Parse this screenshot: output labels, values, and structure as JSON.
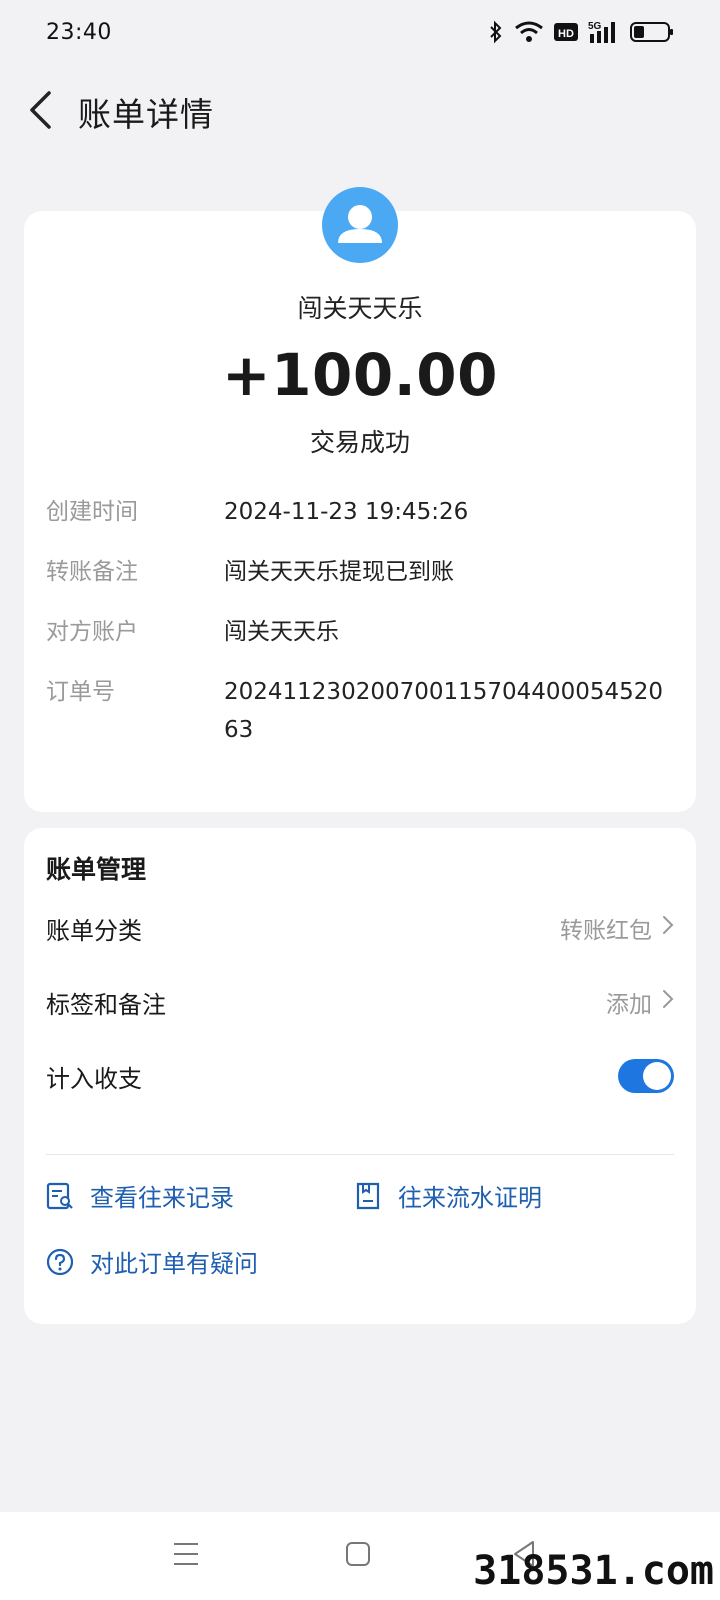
{
  "status_bar": {
    "time": "23:40",
    "icons": [
      "bluetooth-icon",
      "wifi-icon",
      "hd-icon",
      "5g-signal-icon",
      "battery-icon"
    ],
    "hd_label": "HD",
    "network_label": "5G"
  },
  "header": {
    "title": "账单详情",
    "back_icon": "chevron-left-icon"
  },
  "transaction": {
    "avatar_icon": "user-avatar-icon",
    "payee": "闯关天天乐",
    "amount": "+100.00",
    "status": "交易成功",
    "details": [
      {
        "label": "创建时间",
        "value": "2024-11-23 19:45:26"
      },
      {
        "label": "转账备注",
        "value": "闯关天天乐提现已到账"
      },
      {
        "label": "对方账户",
        "value": "闯关天天乐"
      },
      {
        "label": "订单号",
        "value": "20241123020070011570440005452063"
      }
    ]
  },
  "management": {
    "title": "账单管理",
    "rows": [
      {
        "label": "账单分类",
        "value": "转账红包"
      },
      {
        "label": "标签和备注",
        "value": "添加"
      },
      {
        "label": "计入收支",
        "toggle_on": true
      }
    ],
    "links": [
      {
        "label": "查看往来记录",
        "icon": "record-search-icon"
      },
      {
        "label": "往来流水证明",
        "icon": "statement-icon"
      },
      {
        "label": "对此订单有疑问",
        "icon": "question-circle-icon"
      }
    ]
  },
  "nav_bar": {
    "icons": [
      "menu-icon",
      "home-square-icon",
      "back-triangle-icon"
    ]
  },
  "watermark": "318531.com",
  "colors": {
    "accent": "#1e77e0",
    "avatar_bg": "#4aa9f2",
    "link": "#1f5fb0",
    "background": "#f2f2f4"
  }
}
